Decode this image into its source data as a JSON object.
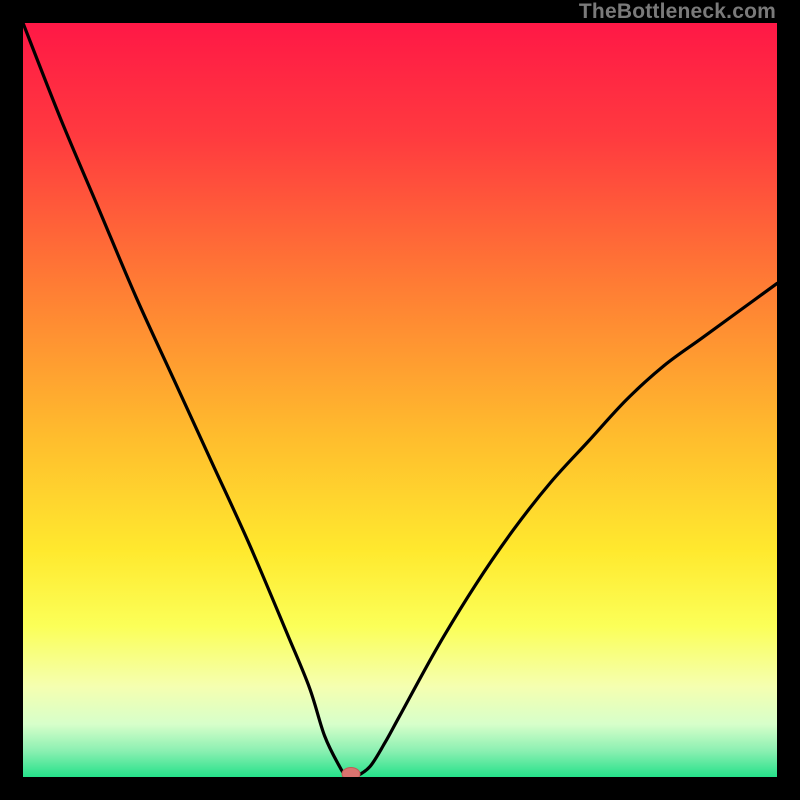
{
  "watermark": "TheBottleneck.com",
  "colors": {
    "frame": "#000000",
    "curve": "#000000",
    "marker_fill": "#d9736f",
    "marker_stroke": "#c05b57",
    "gradient_stops": [
      {
        "offset": 0.0,
        "color": "#ff1846"
      },
      {
        "offset": 0.15,
        "color": "#ff3a3f"
      },
      {
        "offset": 0.35,
        "color": "#ff7d34"
      },
      {
        "offset": 0.55,
        "color": "#ffbd2d"
      },
      {
        "offset": 0.7,
        "color": "#ffe92e"
      },
      {
        "offset": 0.8,
        "color": "#fbff58"
      },
      {
        "offset": 0.88,
        "color": "#f5ffb0"
      },
      {
        "offset": 0.93,
        "color": "#d7ffca"
      },
      {
        "offset": 0.965,
        "color": "#8cf0b2"
      },
      {
        "offset": 1.0,
        "color": "#25e18a"
      }
    ]
  },
  "chart_data": {
    "type": "line",
    "title": "",
    "xlabel": "",
    "ylabel": "",
    "xlim": [
      0,
      100
    ],
    "ylim": [
      0,
      110
    ],
    "note": "Bottleneck-style V curve. y≈0 at x≈43; rises toward both sides. Values are visual estimates from plot.",
    "series": [
      {
        "name": "curve",
        "x": [
          0,
          5,
          10,
          15,
          20,
          25,
          30,
          35,
          38,
          40,
          42,
          43,
          44,
          46,
          48,
          50,
          55,
          60,
          65,
          70,
          75,
          80,
          85,
          90,
          95,
          100
        ],
        "y": [
          110,
          96,
          83,
          70,
          58,
          46,
          34,
          21,
          13,
          6,
          1.5,
          0,
          0,
          1.5,
          5,
          9,
          19,
          28,
          36,
          43,
          49,
          55,
          60,
          64,
          68,
          72
        ]
      }
    ],
    "marker": {
      "x": 43.5,
      "y": 0
    }
  }
}
